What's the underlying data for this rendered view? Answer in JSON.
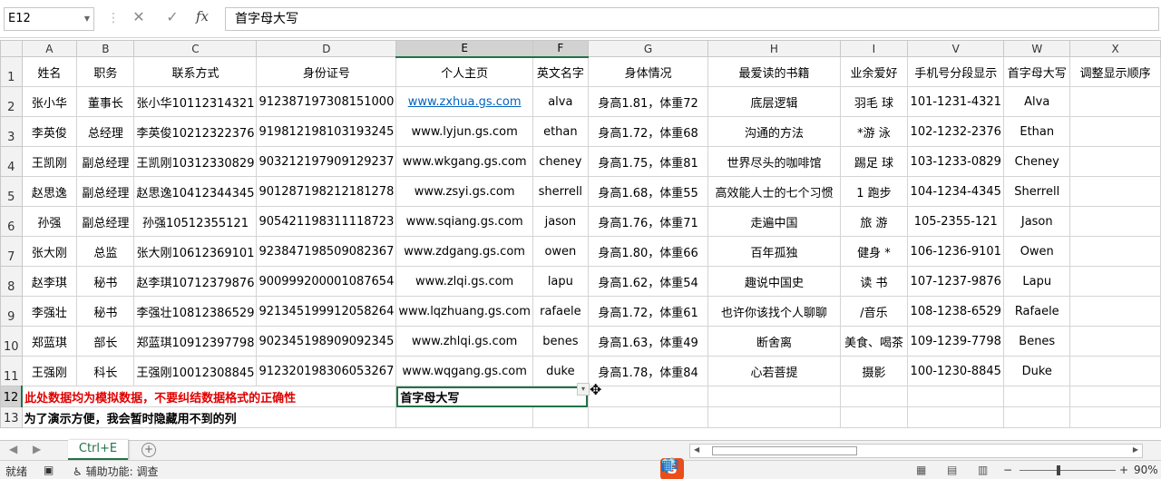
{
  "formula_bar": {
    "name_box": "E12",
    "cancel_icon": "✕",
    "confirm_icon": "✓",
    "fx_label": "fx",
    "formula": "首字母大写"
  },
  "columns": [
    "A",
    "B",
    "C",
    "D",
    "E",
    "F",
    "G",
    "H",
    "I",
    "V",
    "W",
    "X"
  ],
  "header_row": [
    "姓名",
    "职务",
    "联系方式",
    "身份证号",
    "个人主页",
    "英文名字",
    "身体情况",
    "最爱读的书籍",
    "业余爱好",
    "手机号分段显示",
    "首字母大写",
    "调整显示顺序"
  ],
  "rows": [
    [
      "张小华",
      "董事长",
      "张小华10112314321",
      "912387197308151000",
      "www.zxhua.gs.com",
      "alva",
      "身高1.81，体重72",
      "底层逻辑",
      "羽毛  球",
      "101-1231-4321",
      "Alva",
      ""
    ],
    [
      "李英俊",
      "总经理",
      "李英俊10212322376",
      "919812198103193245",
      "www.lyjun.gs.com",
      "ethan",
      "身高1.72，体重68",
      "沟通的方法",
      "*游 泳",
      "102-1232-2376",
      "Ethan",
      ""
    ],
    [
      "王凯刚",
      "副总经理",
      "王凯刚10312330829",
      "903212197909129237",
      "www.wkgang.gs.com",
      "cheney",
      "身高1.75，体重81",
      "世界尽头的咖啡馆",
      "踢足  球",
      "103-1233-0829",
      "Cheney",
      ""
    ],
    [
      "赵思逸",
      "副总经理",
      "赵思逸10412344345",
      "901287198212181278",
      "www.zsyi.gs.com",
      "sherrell",
      "身高1.68，体重55",
      "高效能人士的七个习惯",
      "1 跑步",
      "104-1234-4345",
      "Sherrell",
      ""
    ],
    [
      "孙强",
      "副总经理",
      "孙强10512355121",
      "905421198311118723",
      "www.sqiang.gs.com",
      "jason",
      "身高1.76，体重71",
      "走遍中国",
      "旅  游",
      "105-2355-121",
      "Jason",
      ""
    ],
    [
      "张大刚",
      "总监",
      "张大刚10612369101",
      "923847198509082367",
      "www.zdgang.gs.com",
      "owen",
      "身高1.80，体重66",
      "百年孤独",
      "健身 *",
      "106-1236-9101",
      "Owen",
      ""
    ],
    [
      "赵李琪",
      "秘书",
      "赵李琪10712379876",
      "900999200001087654",
      "www.zlqi.gs.com",
      "lapu",
      "身高1.62，体重54",
      "趣说中国史",
      "读 书",
      "107-1237-9876",
      "Lapu",
      ""
    ],
    [
      "李强壮",
      "秘书",
      "李强壮10812386529",
      "921345199912058264",
      "www.lqzhuang.gs.com",
      "rafaele",
      "身高1.72，体重61",
      "也许你该找个人聊聊",
      "/音乐",
      "108-1238-6529",
      "Rafaele",
      ""
    ],
    [
      "郑蓝琪",
      "部长",
      "郑蓝琪10912397798",
      "902345198909092345",
      "www.zhlqi.gs.com",
      "benes",
      "身高1.63，体重49",
      "断舍离",
      "美食、喝茶",
      "109-1239-7798",
      "Benes",
      ""
    ],
    [
      "王强刚",
      "科长",
      "王强刚10012308845",
      "912320198306053267",
      "www.wqgang.gs.com",
      "duke",
      "身高1.78，体重84",
      "心若菩提",
      "摄影",
      "100-1230-8845",
      "Duke",
      ""
    ]
  ],
  "row12": {
    "note": "此处数据均为模拟数据，不要纠结数据格式的正确性",
    "active_cell": "首字母大写"
  },
  "row13": {
    "note": "为了演示方便，我会暂时隐藏用不到的列"
  },
  "sheet_tabs": {
    "active": "Ctrl+E"
  },
  "status_bar": {
    "ready": "就绪",
    "accessibility": "辅助功能: 调查",
    "zoom": "90%",
    "ime_logo": "S",
    "ime_mode": "中"
  }
}
